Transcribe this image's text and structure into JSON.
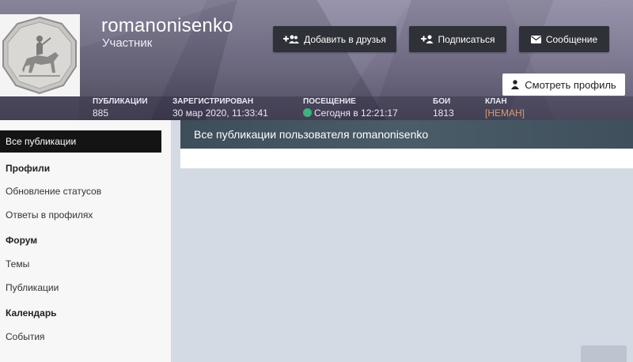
{
  "profile": {
    "username": "romanonisenko",
    "role": "Участник",
    "avatar_icon": "coin-horse-rider-icon"
  },
  "actions": {
    "add_friend": "Добавить в друзья",
    "subscribe": "Подписаться",
    "message": "Сообщение",
    "view_profile": "Смотреть профиль"
  },
  "stats": [
    {
      "label": "ПУБЛИКАЦИИ",
      "value": "885"
    },
    {
      "label": "ЗАРЕГИСТРИРОВАН",
      "value": "30 мар 2020, 11:33:41"
    },
    {
      "label": "ПОСЕЩЕНИЕ",
      "value": "Сегодня в 12:21:17"
    },
    {
      "label": "БОИ",
      "value": "1813"
    },
    {
      "label": "КЛАН",
      "value": "[НЕМАН]"
    }
  ],
  "sidebar": {
    "active": "Все публикации",
    "sections": [
      {
        "heading": "Профили",
        "items": [
          "Обновление статусов",
          "Ответы в профилях"
        ]
      },
      {
        "heading": "Форум",
        "items": [
          "Темы",
          "Публикации"
        ]
      },
      {
        "heading": "Календарь",
        "items": [
          "События"
        ]
      }
    ]
  },
  "main": {
    "title": "Все публикации пользователя romanonisenko"
  },
  "colors": {
    "online": "#3fb27f",
    "clan": "#d79a73",
    "button_dark": "#2f3138"
  }
}
